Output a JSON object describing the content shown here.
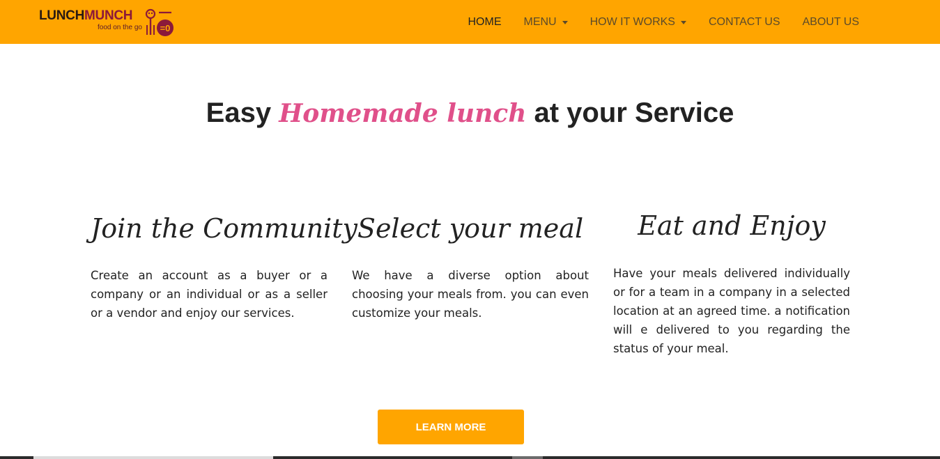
{
  "brand": {
    "word_a": "LUNCH",
    "word_b": "MUNCH",
    "tagline": "food on the go",
    "colors": {
      "primary": "#FFA500",
      "dark": "#2a1a12",
      "maroon": "#8b1a3a"
    }
  },
  "nav": {
    "items": [
      {
        "label": "HOME",
        "active": true,
        "dropdown": false
      },
      {
        "label": "MENU",
        "active": false,
        "dropdown": true
      },
      {
        "label": "HOW IT WORKS",
        "active": false,
        "dropdown": true
      },
      {
        "label": "CONTACT US",
        "active": false,
        "dropdown": false
      },
      {
        "label": "ABOUT US",
        "active": false,
        "dropdown": false
      }
    ]
  },
  "hero": {
    "prefix": "Easy",
    "accent": "Homemade lunch",
    "suffix": "at your Service",
    "accent_color": "#e0508a"
  },
  "features": [
    {
      "title": "Join the Community",
      "text": "Create an account as a buyer or a company or an individual or as a seller or a vendor and enjoy our services."
    },
    {
      "title": "Select your meal",
      "text": "We have a diverse option about choosing your meals from. you can even customize your meals."
    },
    {
      "title": "Eat and Enjoy",
      "text": "Have your meals delivered individually or for a team in a company in a selected location at an agreed time. a notification will e delivered to you regarding the status of your meal."
    }
  ],
  "cta": {
    "label": "LEARN MORE"
  }
}
